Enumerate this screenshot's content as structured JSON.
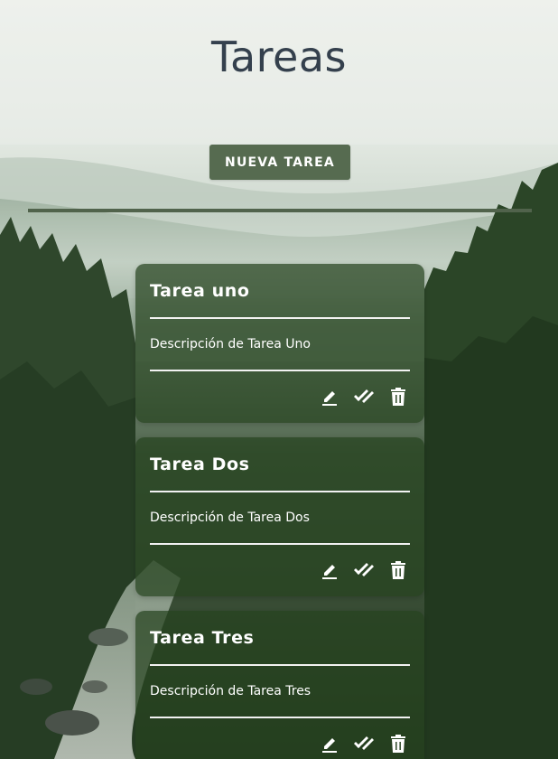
{
  "header": {
    "title": "Tareas",
    "new_task_label": "NUEVA TAREA"
  },
  "tasks": [
    {
      "title": "Tarea uno",
      "description": "Descripción de Tarea Uno",
      "actions": [
        "edit-icon",
        "done-icon",
        "delete-icon"
      ]
    },
    {
      "title": "Tarea Dos",
      "description": "Descripción de Tarea Dos",
      "actions": [
        "edit-icon",
        "done-icon",
        "delete-icon"
      ]
    },
    {
      "title": "Tarea Tres",
      "description": "Descripción de Tarea Tres",
      "actions": [
        "edit-icon",
        "done-icon",
        "delete-icon"
      ]
    }
  ],
  "colors": {
    "title_text": "#34404d",
    "button_bg": "#566b50",
    "divider": "#51634c",
    "card_bg": "#26421e"
  }
}
